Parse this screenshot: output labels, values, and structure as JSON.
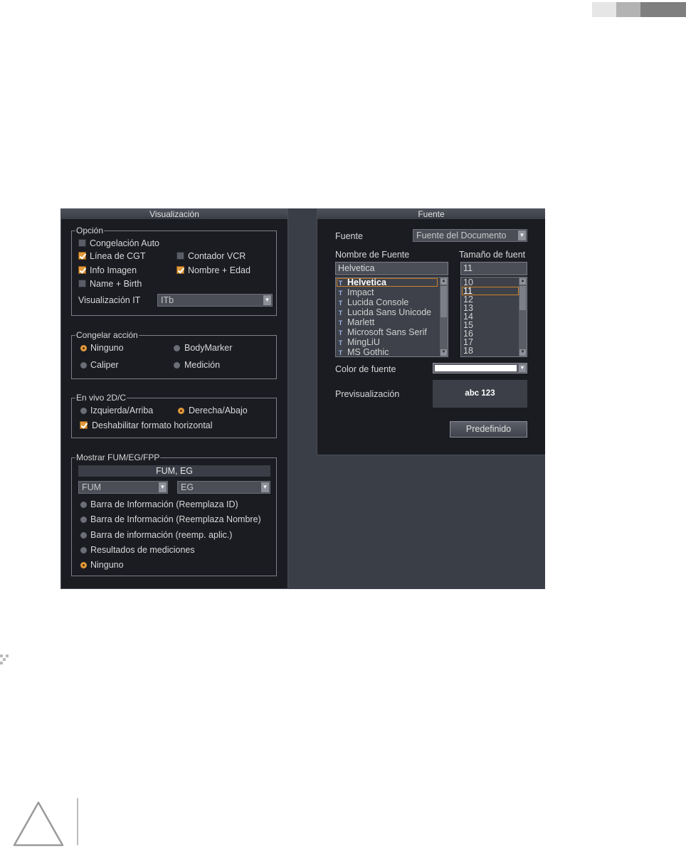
{
  "page": {
    "header_bar_colors": [
      "#e6e6e6",
      "#b3b3b3",
      "#7f7f7f"
    ],
    "warning_icon": "warning-triangle-icon"
  },
  "visualizacion": {
    "title": "Visualización",
    "opcion": {
      "title": "Opción",
      "congelacion_auto": {
        "label": "Congelación Auto",
        "checked": false
      },
      "linea_cgt": {
        "label": "Línea de CGT",
        "checked": true
      },
      "contador_vcr": {
        "label": "Contador VCR",
        "checked": false
      },
      "info_imagen": {
        "label": "Info Imagen",
        "checked": true
      },
      "nombre_edad": {
        "label": "Nombre + Edad",
        "checked": true
      },
      "name_birth": {
        "label": "Name + Birth",
        "checked": false
      },
      "visualizacion_it_label": "Visualización IT",
      "visualizacion_it_value": "ITb"
    },
    "congelar_accion": {
      "title": "Congelar acción",
      "ninguno": "Ninguno",
      "bodymarker": "BodyMarker",
      "caliper": "Caliper",
      "medicion": "Medición",
      "selected": "Ninguno"
    },
    "en_vivo": {
      "title": "En vivo 2D/C",
      "izquierda": "Izquierda/Arriba",
      "derecha": "Derecha/Abajo",
      "selected": "Derecha/Abajo",
      "deshabilitar": {
        "label": "Deshabilitar formato horizontal",
        "checked": true
      }
    },
    "mostrar": {
      "title": "Mostrar FUM/EG/FPP",
      "header": "FUM, EG",
      "combo1": "FUM",
      "combo2": "EG",
      "options": [
        "Barra de Información (Reemplaza ID)",
        "Barra de Información (Reemplaza Nombre)",
        "Barra de información (reemp. aplic.)",
        "Resultados de mediciones",
        "Ninguno"
      ],
      "selected": "Ninguno"
    }
  },
  "fuente": {
    "title": "Fuente",
    "fuente_label": "Fuente",
    "fuente_value": "Fuente del Documento",
    "nombre_label": "Nombre de Fuente",
    "nombre_value": "Helvetica",
    "fonts": [
      "Helvetica",
      "Impact",
      "Lucida Console",
      "Lucida Sans Unicode",
      "Marlett",
      "Microsoft Sans Serif",
      "MingLiU",
      "MS Gothic"
    ],
    "selected_font": "Helvetica",
    "tamano_label": "Tamaño de fuent",
    "tamano_value": "11",
    "sizes": [
      "10",
      "11",
      "12",
      "13",
      "14",
      "15",
      "16",
      "17",
      "18"
    ],
    "selected_size": "11",
    "color_label": "Color de fuente",
    "color_value": "#ffffff",
    "preview_label": "Previsualización",
    "preview_text": "abc 123",
    "predefinido": "Predefinido"
  }
}
